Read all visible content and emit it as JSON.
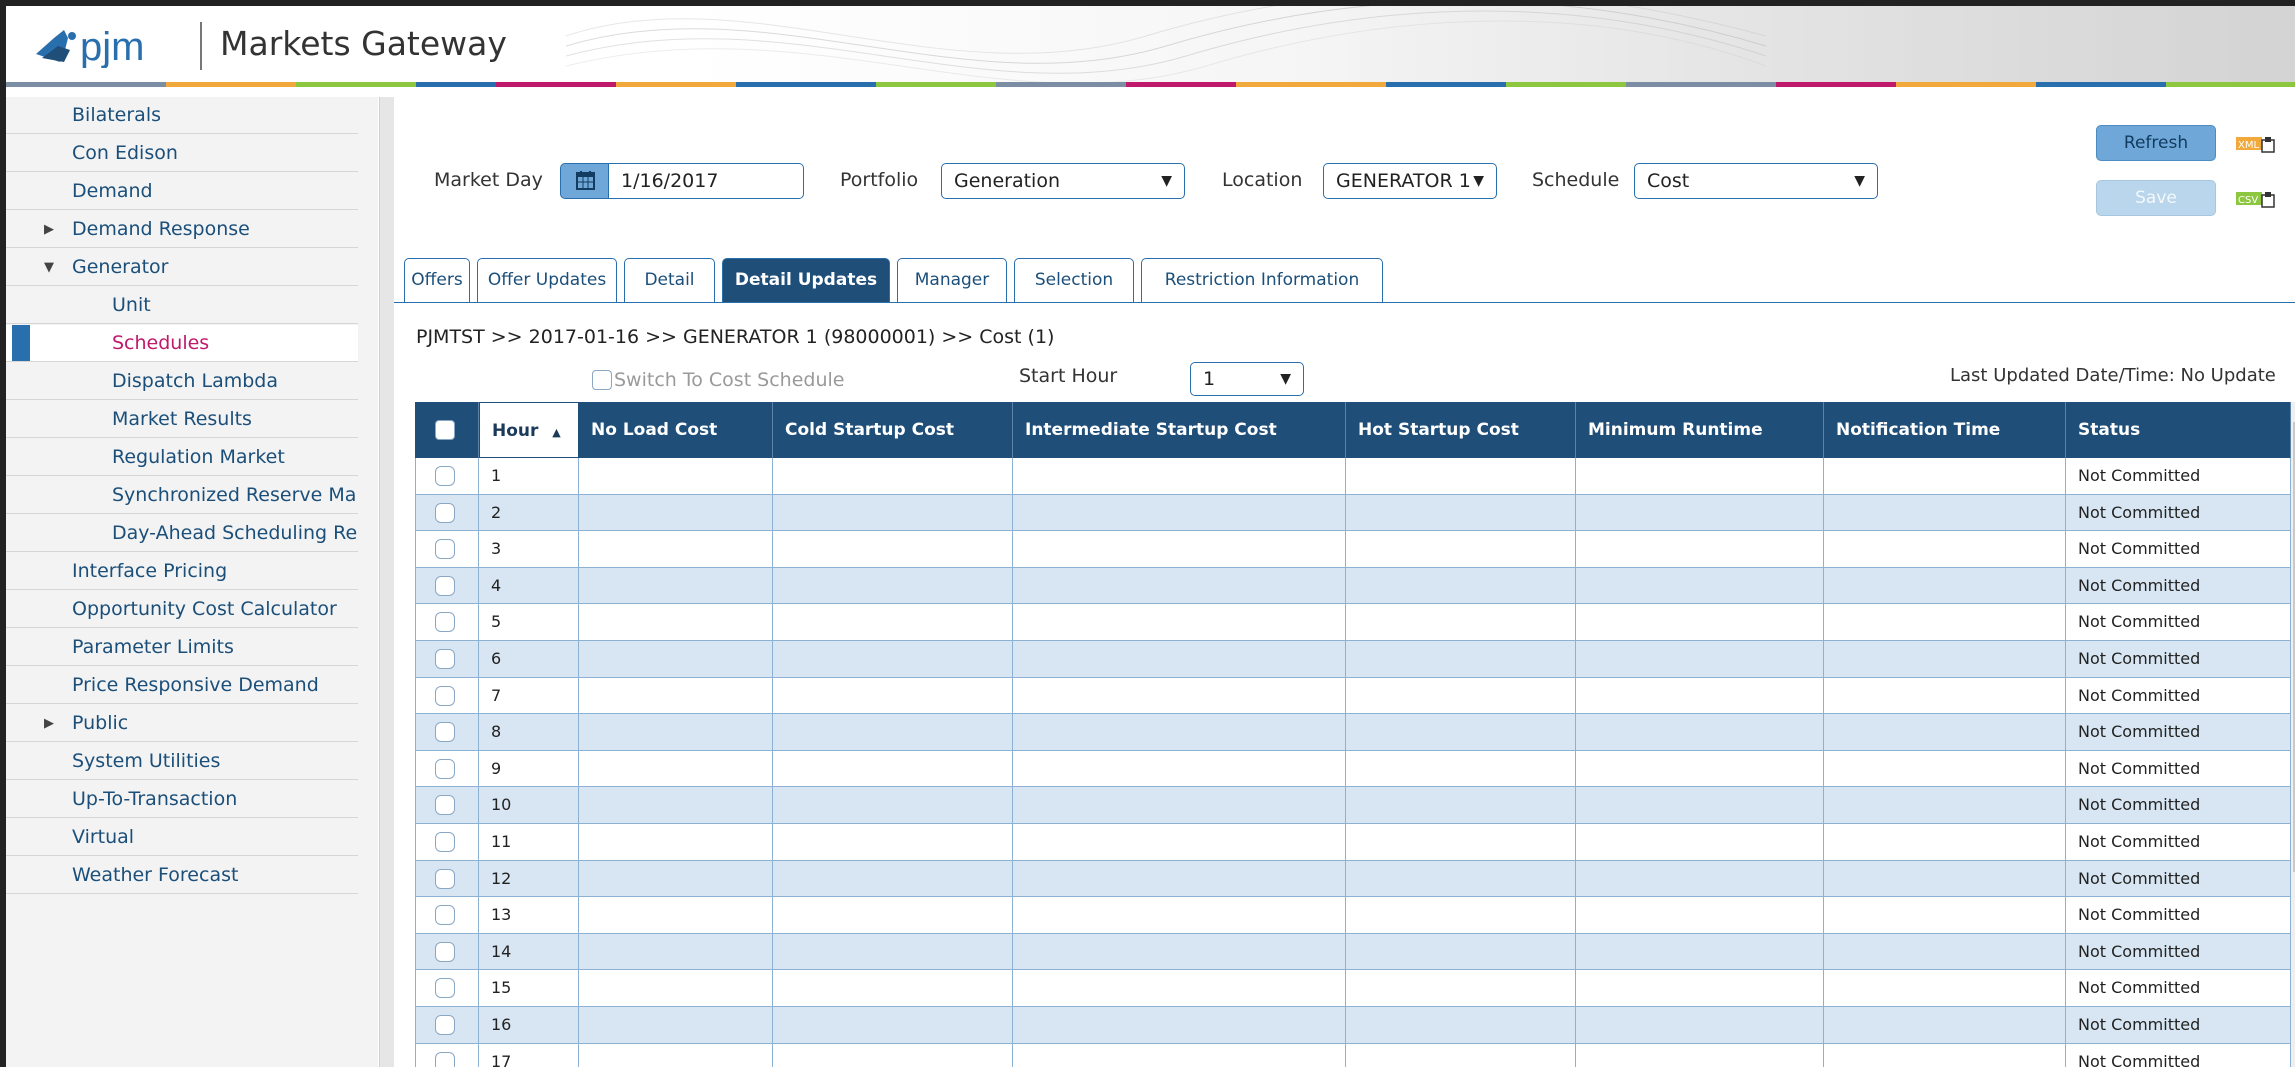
{
  "app": {
    "title": "Markets Gateway",
    "logo_text": "pjm",
    "brand_color": "#1f4e79"
  },
  "sidebar": {
    "items": [
      {
        "label": "Bilaterals",
        "level": 0,
        "expandable": false,
        "selected": false
      },
      {
        "label": "Con Edison",
        "level": 0,
        "expandable": false,
        "selected": false
      },
      {
        "label": "Demand",
        "level": 0,
        "expandable": false,
        "selected": false
      },
      {
        "label": "Demand Response",
        "level": 0,
        "expandable": "collapsed",
        "selected": false
      },
      {
        "label": "Generator",
        "level": 0,
        "expandable": "expanded",
        "selected": false
      },
      {
        "label": "Unit",
        "level": 1,
        "expandable": false,
        "selected": false
      },
      {
        "label": "Schedules",
        "level": 1,
        "expandable": false,
        "selected": true
      },
      {
        "label": "Dispatch Lambda",
        "level": 1,
        "expandable": false,
        "selected": false
      },
      {
        "label": "Market Results",
        "level": 1,
        "expandable": false,
        "selected": false
      },
      {
        "label": "Regulation Market",
        "level": 1,
        "expandable": false,
        "selected": false
      },
      {
        "label": "Synchronized Reserve Mar",
        "level": 1,
        "expandable": false,
        "selected": false
      },
      {
        "label": "Day-Ahead Scheduling Res",
        "level": 1,
        "expandable": false,
        "selected": false
      },
      {
        "label": "Interface Pricing",
        "level": 0,
        "expandable": false,
        "selected": false
      },
      {
        "label": "Opportunity Cost Calculator",
        "level": 0,
        "expandable": false,
        "selected": false
      },
      {
        "label": "Parameter Limits",
        "level": 0,
        "expandable": false,
        "selected": false
      },
      {
        "label": "Price Responsive Demand",
        "level": 0,
        "expandable": false,
        "selected": false
      },
      {
        "label": "Public",
        "level": 0,
        "expandable": "collapsed",
        "selected": false
      },
      {
        "label": "System Utilities",
        "level": 0,
        "expandable": false,
        "selected": false
      },
      {
        "label": "Up-To-Transaction",
        "level": 0,
        "expandable": false,
        "selected": false
      },
      {
        "label": "Virtual",
        "level": 0,
        "expandable": false,
        "selected": false
      },
      {
        "label": "Weather Forecast",
        "level": 0,
        "expandable": false,
        "selected": false
      }
    ]
  },
  "filters": {
    "market_day_label": "Market Day",
    "market_day_value": "1/16/2017",
    "portfolio_label": "Portfolio",
    "portfolio_value": "Generation",
    "location_label": "Location",
    "location_value": "GENERATOR 1",
    "schedule_label": "Schedule",
    "schedule_value": "Cost"
  },
  "actions": {
    "refresh_label": "Refresh",
    "save_label": "Save",
    "xml_label": "XML",
    "csv_label": "CSV"
  },
  "tabs": [
    {
      "label": "Offers",
      "active": false
    },
    {
      "label": "Offer Updates",
      "active": false
    },
    {
      "label": "Detail",
      "active": false
    },
    {
      "label": "Detail Updates",
      "active": true
    },
    {
      "label": "Manager",
      "active": false
    },
    {
      "label": "Selection",
      "active": false
    },
    {
      "label": "Restriction Information",
      "active": false
    }
  ],
  "content": {
    "breadcrumb": "PJMTST >> 2017-01-16 >> GENERATOR 1 (98000001) >> Cost (1)",
    "switch_label": "Switch To Cost Schedule",
    "start_hour_label": "Start Hour",
    "start_hour_value": "1",
    "last_updated": "Last Updated Date/Time: No Update"
  },
  "grid": {
    "columns": [
      "",
      "Hour",
      "No Load Cost",
      "Cold Startup Cost",
      "Intermediate Startup Cost",
      "Hot Startup Cost",
      "Minimum Runtime",
      "Notification Time",
      "Status"
    ],
    "sort_column": "Hour",
    "sort_direction": "ascending",
    "rows": [
      {
        "hour": "1",
        "status": "Not Committed"
      },
      {
        "hour": "2",
        "status": "Not Committed"
      },
      {
        "hour": "3",
        "status": "Not Committed"
      },
      {
        "hour": "4",
        "status": "Not Committed"
      },
      {
        "hour": "5",
        "status": "Not Committed"
      },
      {
        "hour": "6",
        "status": "Not Committed"
      },
      {
        "hour": "7",
        "status": "Not Committed"
      },
      {
        "hour": "8",
        "status": "Not Committed"
      },
      {
        "hour": "9",
        "status": "Not Committed"
      },
      {
        "hour": "10",
        "status": "Not Committed"
      },
      {
        "hour": "11",
        "status": "Not Committed"
      },
      {
        "hour": "12",
        "status": "Not Committed"
      },
      {
        "hour": "13",
        "status": "Not Committed"
      },
      {
        "hour": "14",
        "status": "Not Committed"
      },
      {
        "hour": "15",
        "status": "Not Committed"
      },
      {
        "hour": "16",
        "status": "Not Committed"
      },
      {
        "hour": "17",
        "status": "Not Committed"
      }
    ]
  }
}
